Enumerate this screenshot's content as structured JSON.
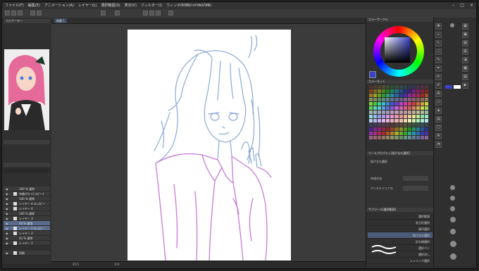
{
  "app": {
    "title": "CLIP STUDIO PAINT PRO",
    "menu": [
      "ファイル(F)",
      "編集(E)",
      "アニメーション(A)",
      "レイヤー(L)",
      "選択範囲(S)",
      "表示(V)",
      "フィルター(I)",
      "ウィンドウ(W)",
      "ヘルプ(H)"
    ]
  },
  "canvas_tab": {
    "label": "無題-1"
  },
  "navigator": {
    "title": "ナビゲーター"
  },
  "layers": [
    {
      "label": "100 % 通常",
      "eye": "◉"
    },
    {
      "label": "布着付りリ(コピー)",
      "eye": "◉"
    },
    {
      "label": "100 % 通常",
      "eye": "◉"
    },
    {
      "label": "レイヤー 4 のコピー",
      "eye": "◉"
    },
    {
      "label": "レイヤー 4",
      "eye": "◉"
    },
    {
      "label": "100 % 通常",
      "eye": "◉"
    },
    {
      "label": "レイヤー 3",
      "eye": "◉"
    },
    {
      "label": "40 % 通常",
      "eye": "◉"
    },
    {
      "label": "レイヤー 2 のコピー",
      "eye": "◉"
    },
    {
      "label": "レイヤー 2",
      "eye": "◉"
    },
    {
      "label": "42 % 通常",
      "eye": "◉"
    },
    {
      "label": "レイヤー 1",
      "eye": "◉"
    },
    {
      "label": "用紙",
      "eye": "◉"
    }
  ],
  "color_panel": {
    "title": "カラーサークル"
  },
  "palette_panel": {
    "title": "カラーセット"
  },
  "tool_property": {
    "title": "ツールプロパティ[投げなわ選択]",
    "row1": "投げなわ選択",
    "row2": "作成方法",
    "row3": "アンチエイリアス"
  },
  "sub_tools": {
    "title": "サブツール[選択範囲]",
    "items": [
      "選択範囲",
      "長方形選択",
      "楕円選択",
      "投げなわ選択",
      "折れ線選択",
      "選択ペン",
      "選択消し",
      "シュリンク選択"
    ]
  },
  "status": {
    "zoom": "25.5",
    "info": "0.0"
  },
  "colors": {
    "main": "#3a43c9",
    "accent": "#5a6b8c"
  }
}
